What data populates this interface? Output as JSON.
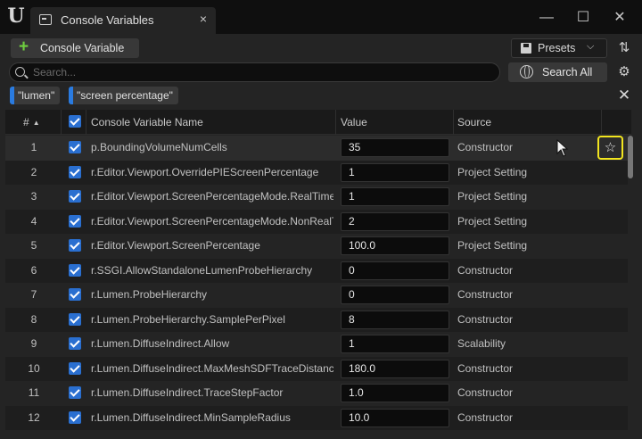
{
  "window": {
    "tab_title": "Console Variables",
    "tab_close": "×",
    "minimize": "—",
    "maximize": "☐",
    "close": "✕"
  },
  "toolbar": {
    "add_label": "Console Variable",
    "presets_label": "Presets",
    "search_placeholder": "Search...",
    "search_all_label": "Search All"
  },
  "filters": [
    {
      "label": "\"lumen\""
    },
    {
      "label": "\"screen percentage\""
    }
  ],
  "table": {
    "headers": {
      "num": "#",
      "name": "Console Variable Name",
      "value": "Value",
      "source": "Source"
    },
    "rows": [
      {
        "num": "1",
        "name": "p.BoundingVolumeNumCells",
        "value": "35",
        "source": "Constructor"
      },
      {
        "num": "2",
        "name": "r.Editor.Viewport.OverridePIEScreenPercentage",
        "value": "1",
        "source": "Project Setting"
      },
      {
        "num": "3",
        "name": "r.Editor.Viewport.ScreenPercentageMode.RealTime",
        "value": "1",
        "source": "Project Setting"
      },
      {
        "num": "4",
        "name": "r.Editor.Viewport.ScreenPercentageMode.NonRealTime",
        "value": "2",
        "source": "Project Setting"
      },
      {
        "num": "5",
        "name": "r.Editor.Viewport.ScreenPercentage",
        "value": "100.0",
        "source": "Project Setting"
      },
      {
        "num": "6",
        "name": "r.SSGI.AllowStandaloneLumenProbeHierarchy",
        "value": "0",
        "source": "Constructor"
      },
      {
        "num": "7",
        "name": "r.Lumen.ProbeHierarchy",
        "value": "0",
        "source": "Constructor"
      },
      {
        "num": "8",
        "name": "r.Lumen.ProbeHierarchy.SamplePerPixel",
        "value": "8",
        "source": "Constructor"
      },
      {
        "num": "9",
        "name": "r.Lumen.DiffuseIndirect.Allow",
        "value": "1",
        "source": "Scalability"
      },
      {
        "num": "10",
        "name": "r.Lumen.DiffuseIndirect.MaxMeshSDFTraceDistance",
        "value": "180.0",
        "source": "Constructor"
      },
      {
        "num": "11",
        "name": "r.Lumen.DiffuseIndirect.TraceStepFactor",
        "value": "1.0",
        "source": "Constructor"
      },
      {
        "num": "12",
        "name": "r.Lumen.DiffuseIndirect.MinSampleRadius",
        "value": "10.0",
        "source": "Constructor"
      }
    ]
  },
  "colors": {
    "accent": "#2a7be0",
    "add_icon": "#6fcf3f",
    "highlight": "#f2e51f"
  }
}
